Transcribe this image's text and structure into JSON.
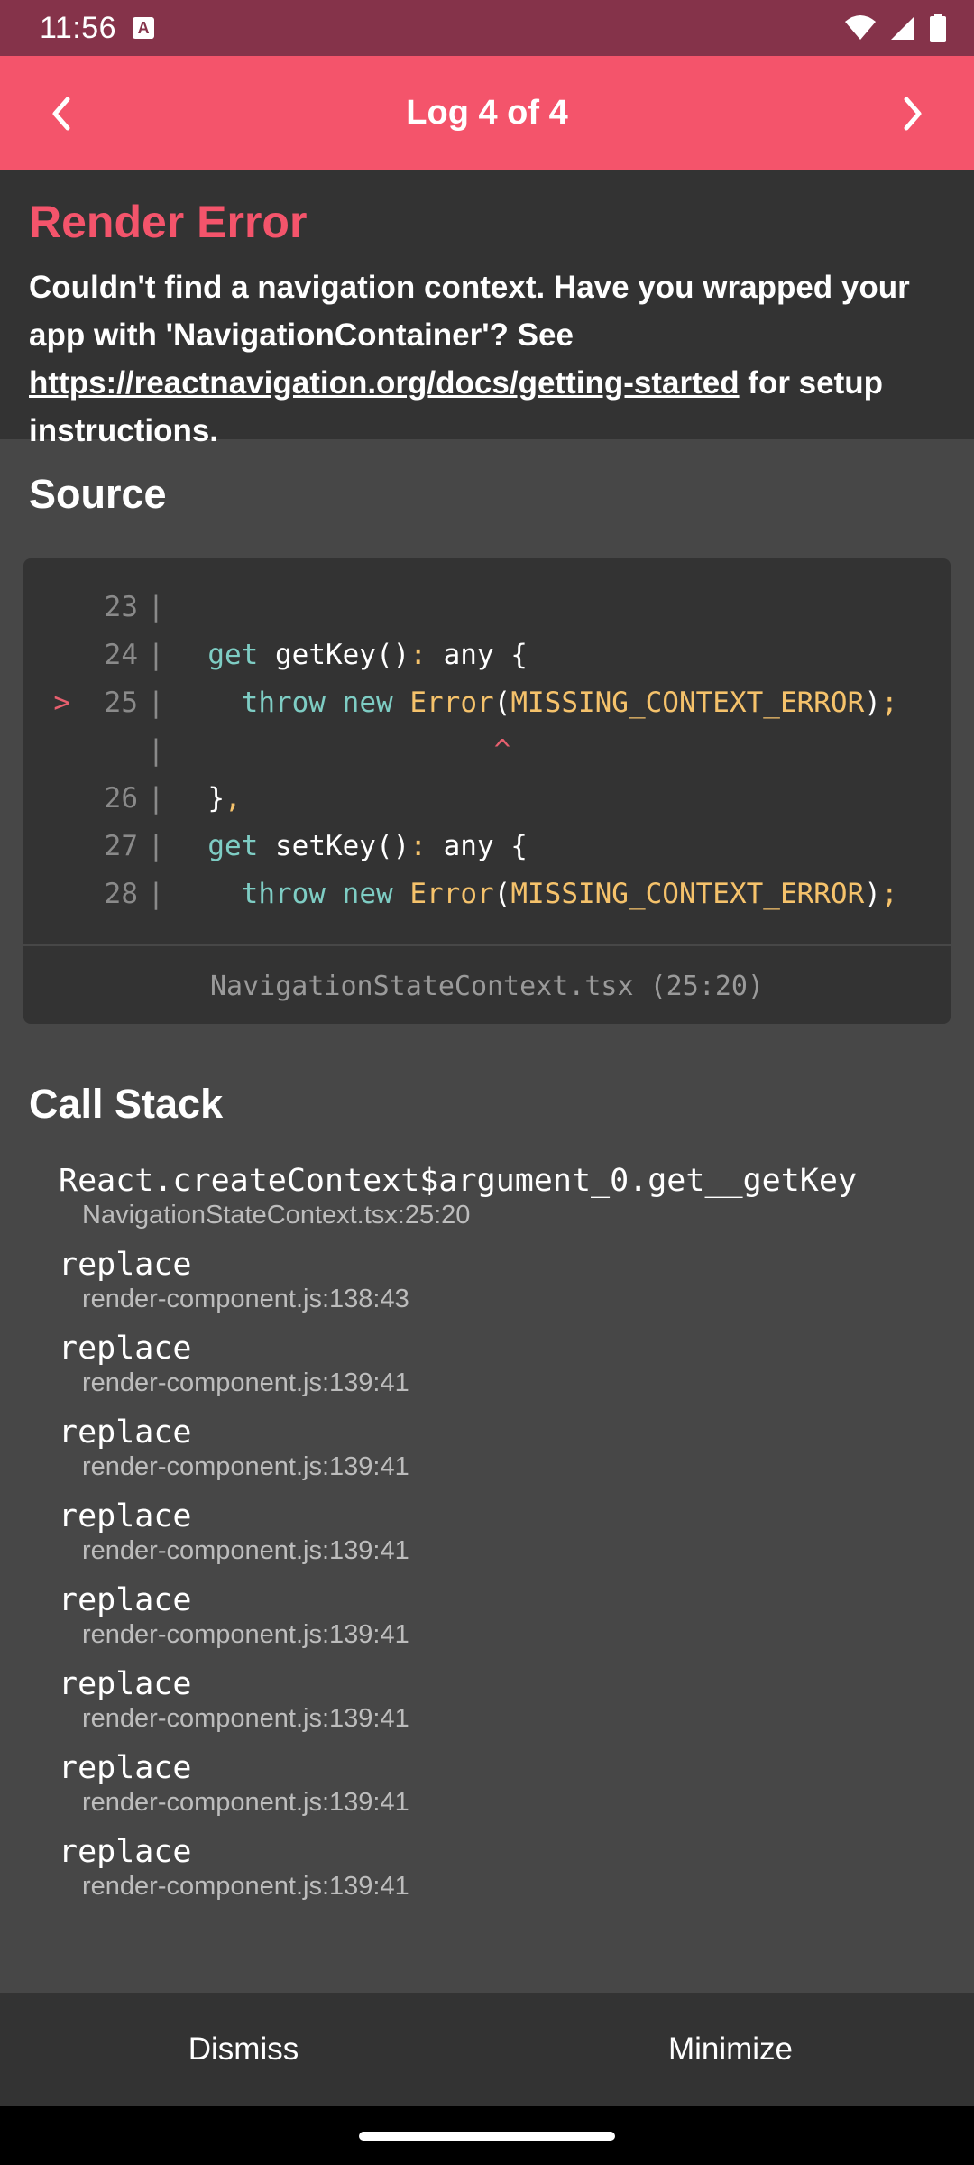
{
  "status_bar": {
    "time": "11:56",
    "notification_icon": "a-icon",
    "icons": [
      "wifi-icon",
      "cell-signal-icon",
      "battery-icon"
    ]
  },
  "header": {
    "title": "Log 4 of 4",
    "prev_icon": "chevron-left-icon",
    "next_icon": "chevron-right-icon",
    "color": "#f4546b"
  },
  "error": {
    "title": "Render Error",
    "message_before": "Couldn't find a navigation context. Have you wrapped your app with 'NavigationContainer'? See ",
    "link": "https://reactnavigation.org/docs/getting-started",
    "message_after": " for setup instructions."
  },
  "source": {
    "title": "Source",
    "lines": [
      {
        "marker": "",
        "num": "23",
        "code": ""
      },
      {
        "marker": "",
        "num": "24",
        "code": "  get getKey(): any {"
      },
      {
        "marker": ">",
        "num": "25",
        "code": "    throw new Error(MISSING_CONTEXT_ERROR);"
      },
      {
        "marker": "",
        "num": "",
        "code": "                   ^"
      },
      {
        "marker": "",
        "num": "26",
        "code": "  },"
      },
      {
        "marker": "",
        "num": "27",
        "code": "  get setKey(): any {"
      },
      {
        "marker": "",
        "num": "28",
        "code": "    throw new Error(MISSING_CONTEXT_ERROR);"
      }
    ],
    "file": "NavigationStateContext.tsx (25:20)"
  },
  "call_stack": {
    "title": "Call Stack",
    "frames": [
      {
        "method": "React.createContext$argument_0.get__getKey",
        "location": "NavigationStateContext.tsx:25:20"
      },
      {
        "method": "replace",
        "location": "render-component.js:138:43"
      },
      {
        "method": "replace",
        "location": "render-component.js:139:41"
      },
      {
        "method": "replace",
        "location": "render-component.js:139:41"
      },
      {
        "method": "replace",
        "location": "render-component.js:139:41"
      },
      {
        "method": "replace",
        "location": "render-component.js:139:41"
      },
      {
        "method": "replace",
        "location": "render-component.js:139:41"
      },
      {
        "method": "replace",
        "location": "render-component.js:139:41"
      },
      {
        "method": "replace",
        "location": "render-component.js:139:41"
      }
    ]
  },
  "footer": {
    "dismiss": "Dismiss",
    "minimize": "Minimize"
  }
}
